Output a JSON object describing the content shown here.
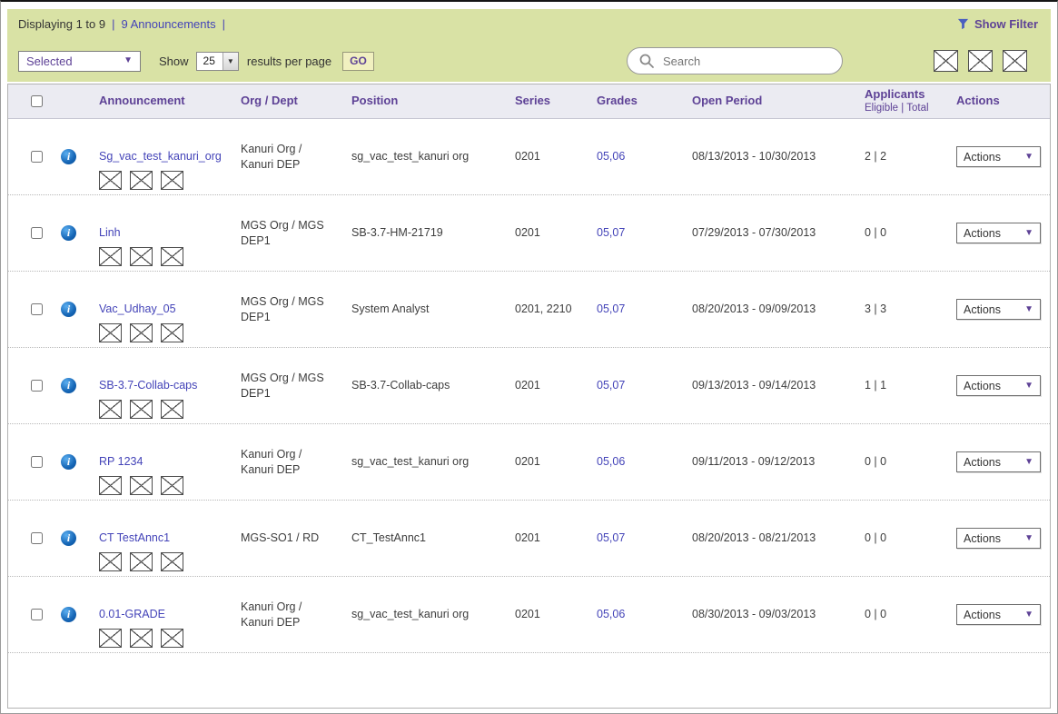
{
  "toolbar": {
    "displaying_text": "Displaying 1 to 9",
    "separator": "|",
    "announcements_link": "9 Announcements",
    "show_filter_label": "Show Filter",
    "selected_dropdown_label": "Selected",
    "show_label": "Show",
    "per_page_value": "25",
    "results_per_page_label": "results per page",
    "go_button_label": "GO",
    "search_placeholder": "Search"
  },
  "icons": {
    "caret_down": "▼",
    "info_glyph": "i",
    "filter": "funnel",
    "search": "magnifier",
    "broken_image": "x-box"
  },
  "table": {
    "headers": {
      "announcement": "Announcement",
      "org_dept": "Org / Dept",
      "position": "Position",
      "series": "Series",
      "grades": "Grades",
      "open_period": "Open Period",
      "applicants": "Applicants",
      "applicants_sub": "Eligible | Total",
      "actions": "Actions"
    },
    "rows": [
      {
        "announcement": "Sg_vac_test_kanuri_org",
        "org_dept": "Kanuri Org / Kanuri DEP",
        "position": "sg_vac_test_kanuri org",
        "series": "0201",
        "grades": "05,06",
        "open_period": "08/13/2013 - 10/30/2013",
        "applicants": "2 | 2",
        "actions_label": "Actions"
      },
      {
        "announcement": "Linh",
        "org_dept": "MGS Org / MGS DEP1",
        "position": "SB-3.7-HM-21719",
        "series": "0201",
        "grades": "05,07",
        "open_period": "07/29/2013 - 07/30/2013",
        "applicants": "0 | 0",
        "actions_label": "Actions"
      },
      {
        "announcement": "Vac_Udhay_05",
        "org_dept": "MGS Org / MGS DEP1",
        "position": "System Analyst",
        "series": "0201, 2210",
        "grades": "05,07",
        "open_period": "08/20/2013 - 09/09/2013",
        "applicants": "3 | 3",
        "actions_label": "Actions"
      },
      {
        "announcement": "SB-3.7-Collab-caps",
        "org_dept": "MGS Org / MGS DEP1",
        "position": "SB-3.7-Collab-caps",
        "series": "0201",
        "grades": "05,07",
        "open_period": "09/13/2013 - 09/14/2013",
        "applicants": "1 | 1",
        "actions_label": "Actions"
      },
      {
        "announcement": "RP 1234",
        "org_dept": "Kanuri Org / Kanuri DEP",
        "position": "sg_vac_test_kanuri org",
        "series": "0201",
        "grades": "05,06",
        "open_period": "09/11/2013 - 09/12/2013",
        "applicants": "0 | 0",
        "actions_label": "Actions"
      },
      {
        "announcement": "CT TestAnnc1",
        "org_dept": "MGS-SO1 / RD",
        "position": "CT_TestAnnc1",
        "series": "0201",
        "grades": "05,07",
        "open_period": "08/20/2013 - 08/21/2013",
        "applicants": "0 | 0",
        "actions_label": "Actions"
      },
      {
        "announcement": "0.01-GRADE",
        "org_dept": "Kanuri Org / Kanuri DEP",
        "position": "sg_vac_test_kanuri org",
        "series": "0201",
        "grades": "05,06",
        "open_period": "08/30/2013 - 09/03/2013",
        "applicants": "0 | 0",
        "actions_label": "Actions"
      }
    ]
  },
  "colors": {
    "toolbar_bg": "#d9e2a5",
    "table_header_bg": "#ebebf2",
    "heading_text": "#5e4296",
    "link": "#4343b8",
    "body_text": "#3d3d3d",
    "info_icon_blue": "#1565b5",
    "go_button_bg": "#f1f0c0"
  }
}
